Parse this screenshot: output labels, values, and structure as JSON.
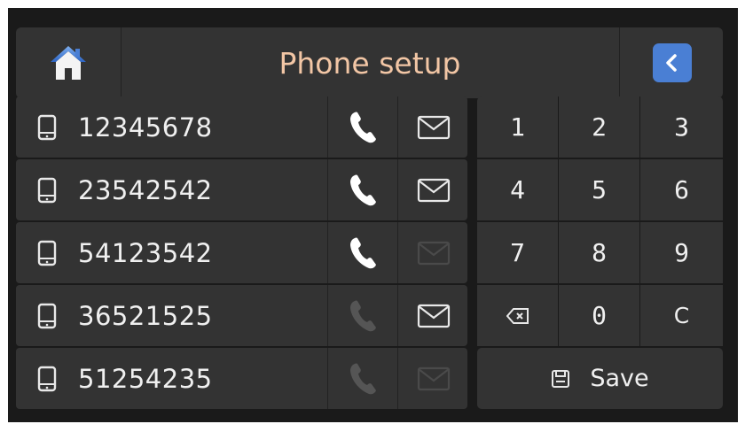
{
  "header": {
    "title": "Phone setup",
    "home_icon": "home-icon",
    "back_icon": "back-arrow-icon",
    "back_color": "#4a7fd4",
    "title_color": "#f2c6a5"
  },
  "contacts": [
    {
      "number": "12345678",
      "call_enabled": true,
      "sms_enabled": true
    },
    {
      "number": "23542542",
      "call_enabled": true,
      "sms_enabled": true
    },
    {
      "number": "54123542",
      "call_enabled": true,
      "sms_enabled": false
    },
    {
      "number": "36521525",
      "call_enabled": false,
      "sms_enabled": true
    },
    {
      "number": "51254235",
      "call_enabled": false,
      "sms_enabled": false
    }
  ],
  "keypad": {
    "keys": [
      "1",
      "2",
      "3",
      "4",
      "5",
      "6",
      "7",
      "8",
      "9",
      "backspace",
      "0",
      "C"
    ],
    "save_label": "Save"
  }
}
